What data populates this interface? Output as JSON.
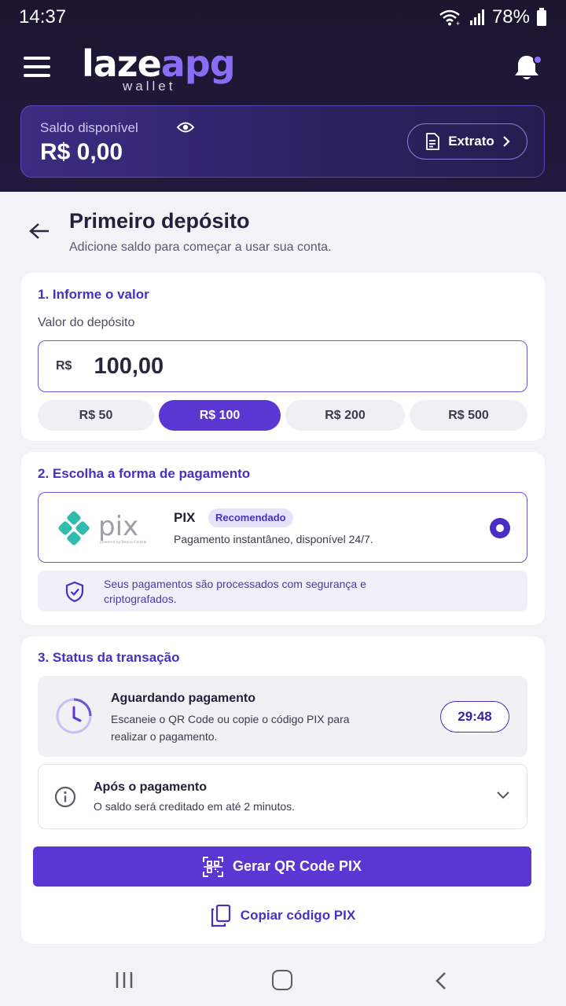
{
  "status_bar": {
    "time": "14:37",
    "battery": "78%"
  },
  "header": {
    "logo_part1": "laze",
    "logo_part2": "apg",
    "logo_sub": "wallet",
    "menu_icon": "hamburger-menu-icon",
    "notification_icon": "bell-icon"
  },
  "balance": {
    "label": "Saldo disponível",
    "value": "R$ 0,00",
    "statement_button": "Extrato"
  },
  "page": {
    "title": "Primeiro depósito",
    "subtitle": "Adicione saldo para começar a usar sua conta."
  },
  "amount_section": {
    "title": "1. Informe o valor",
    "field_label": "Valor do depósito",
    "currency": "R$",
    "value": "100,00",
    "quick_amounts": [
      {
        "label": "R$ 50",
        "selected": false
      },
      {
        "label": "R$ 100",
        "selected": true
      },
      {
        "label": "R$ 200",
        "selected": false
      },
      {
        "label": "R$ 500",
        "selected": false
      }
    ]
  },
  "payment_section": {
    "title": "2. Escolha a forma de pagamento",
    "method_name": "PIX",
    "badge": "Recomendado",
    "description": "Pagamento instantâneo, disponível 24/7.",
    "logo_text": "pix",
    "logo_caption": "powered by Banco Central",
    "security_note": "Seus pagamentos são processados com segurança e criptografados."
  },
  "status_section": {
    "title": "3. Status da transação",
    "waiting_title": "Aguardando pagamento",
    "waiting_desc": "Escaneie o QR Code ou copie o código PIX para realizar o pagamento.",
    "timer": "29:48",
    "after_title": "Após o pagamento",
    "after_desc": "O saldo será creditado em até 2 minutos.",
    "generate_button": "Gerar QR Code PIX",
    "copy_button": "Copiar código PIX"
  },
  "colors": {
    "accent": "#5a36d3",
    "header_bg": "#1b1530",
    "page_bg": "#f3f2f7",
    "pix_teal": "#32bcad"
  }
}
